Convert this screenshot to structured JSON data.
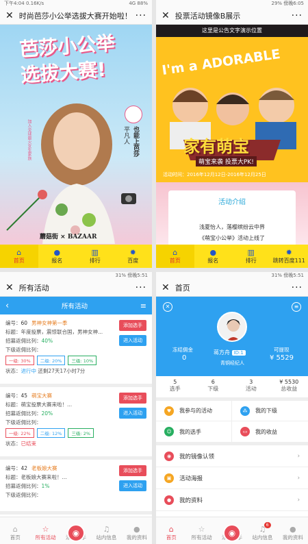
{
  "q1": {
    "status_left": "下午4:04",
    "status_speed": "0.16K/s",
    "status_right": "4G 88%",
    "title": "时尚芭莎小公举选拔大赛开始啦！",
    "poster_line1": "芭莎小公举",
    "poster_line2": "选拔大赛!",
    "side_text1": "也能上芭莎",
    "side_text2": "平凡人",
    "side_text3": "加入全球最火女生家族",
    "logo_left": "蘑菇街",
    "logo_right": "BAZAAR",
    "nav": [
      "首页",
      "报名",
      "排行",
      "百度"
    ]
  },
  "q2": {
    "status_right": "29% 傍晚6:05",
    "title": "投票活动镜像B展示",
    "notice": "这里是公告文字演示位置",
    "adorable": "I'm a ADORABLE",
    "poster_title": "家有萌宝",
    "poster_sub": "萌宝来袭 投票大PK!",
    "time_label": "活动时间：",
    "time_value": "2016年12月12日-2016年12月25日",
    "intro_title": "活动介绍",
    "intro_line1": "浅夏怡人，落樱缤纷云中界",
    "intro_line2": "《萌宝小公举》活动上线了",
    "nav": [
      "首页",
      "报名",
      "排行",
      "跳转百度111"
    ]
  },
  "q3": {
    "status_right": "31% 傍晚5:51",
    "title": "所有活动",
    "header": "所有活动",
    "labels": {
      "no": "编号：",
      "subject": "标题：",
      "rate": "招募返佣比列：",
      "lower": "下级返佣比列：",
      "state": "状态："
    },
    "add_label": "添加选手",
    "enter_label": "进入活动",
    "cards": [
      {
        "no": "60",
        "name": "男神女神第一季",
        "subject": "年度投票，震惊联合国，男神女神...",
        "rate": "40%",
        "l1": "一级: 30%",
        "l2": "二级: 20%",
        "l3": "三级: 10%",
        "state": "进行中",
        "extra": "还剩27天17小时7分"
      },
      {
        "no": "45",
        "name": "萌宝大赛",
        "subject": "萌宝投票大赛来啦！...",
        "rate": "20%",
        "l1": "一级: 22%",
        "l2": "二级: 12%",
        "l3": "三级: 2%",
        "state": "已结束",
        "extra": ""
      },
      {
        "no": "42",
        "name": "老板娘大赛",
        "subject": "老板娘大赛来啦！...",
        "rate": "1%",
        "l1": "",
        "l2": "",
        "l3": "",
        "state": "",
        "extra": ""
      }
    ],
    "nav": [
      "首页",
      "所有活动",
      "添加选手",
      "站内信息",
      "我的资料"
    ]
  },
  "q4": {
    "status_right": "31% 傍晚5:51",
    "title": "首页",
    "frozen_label": "冻结佣金",
    "frozen_value": "0",
    "user_name": "蒋方舟",
    "user_id": "ID:1",
    "user_role": "青铜经纪人",
    "withdraw_label": "可提现",
    "withdraw_value": "¥ 5529",
    "stats": [
      {
        "v": "5",
        "l": "选手"
      },
      {
        "v": "6",
        "l": "下级"
      },
      {
        "v": "3",
        "l": "活动"
      },
      {
        "v": "¥ 5530",
        "l": "总收益"
      }
    ],
    "grid": [
      "我参与的活动",
      "我的下级",
      "我的选手",
      "我的收益"
    ],
    "menu": [
      "我的镜像认领",
      "活动海报",
      "我的资料"
    ],
    "nav": [
      "首页",
      "所有活动",
      "添加选手",
      "站内信息",
      "我的资料"
    ],
    "badge": "6"
  }
}
